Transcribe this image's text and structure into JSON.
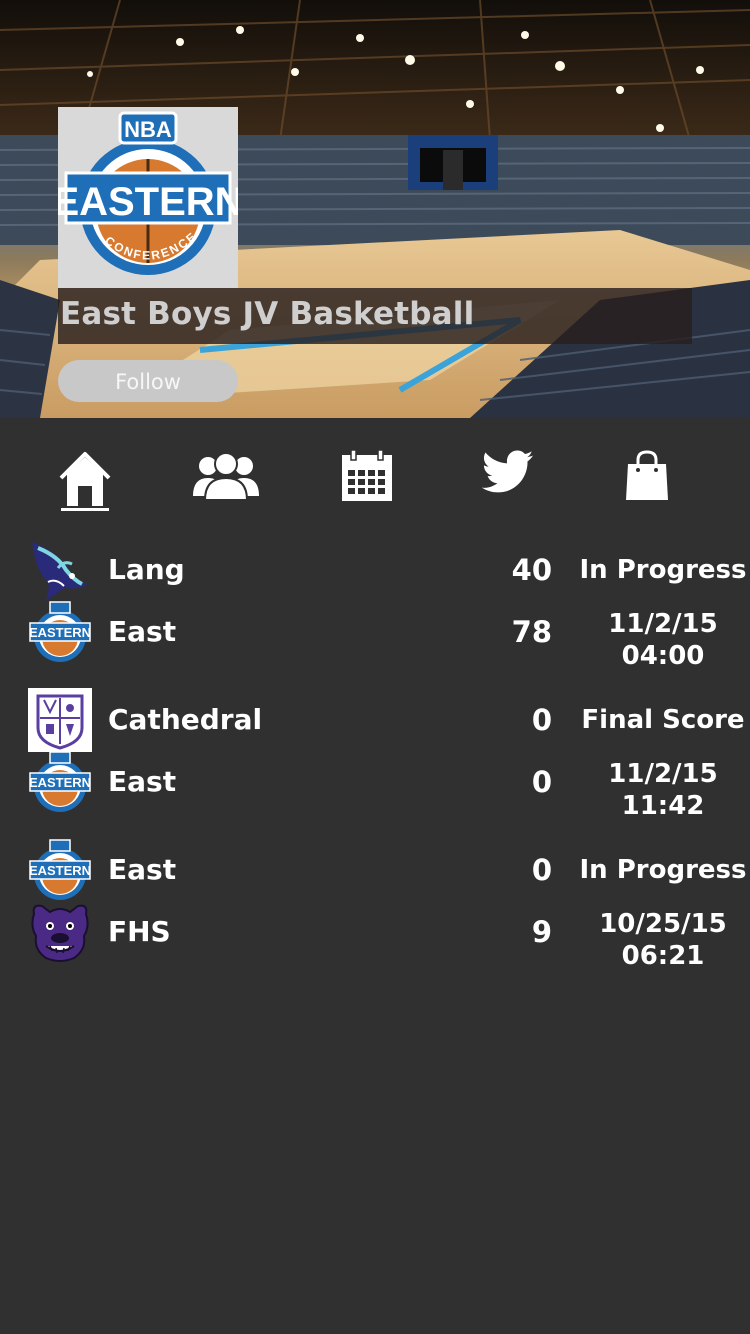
{
  "header": {
    "team_name": "East Boys JV Basketball",
    "follow_label": "Follow",
    "team_logo_text_top": "NBA",
    "team_logo_text_main": "EASTERN",
    "team_logo_text_bottom": "CONFERENCE"
  },
  "nav": [
    {
      "icon": "home-icon"
    },
    {
      "icon": "users-icon"
    },
    {
      "icon": "calendar-icon"
    },
    {
      "icon": "twitter-icon"
    },
    {
      "icon": "shopping-bag-icon"
    }
  ],
  "games": [
    {
      "team1": {
        "name": "Lang",
        "score": "40",
        "logo": "hornet-logo"
      },
      "team2": {
        "name": "East",
        "score": "78",
        "logo": "eastern-logo"
      },
      "status": "In Progress",
      "date": "11/2/15",
      "time": "04:00"
    },
    {
      "team1": {
        "name": "Cathedral",
        "score": "0",
        "logo": "cathedral-crest-logo"
      },
      "team2": {
        "name": "East",
        "score": "0",
        "logo": "eastern-logo"
      },
      "status": "Final Score",
      "date": "11/2/15",
      "time": "11:42"
    },
    {
      "team1": {
        "name": "East",
        "score": "0",
        "logo": "eastern-logo"
      },
      "team2": {
        "name": "FHS",
        "score": "9",
        "logo": "bulldog-logo"
      },
      "status": "In Progress",
      "date": "10/25/15",
      "time": "06:21"
    }
  ],
  "colors": {
    "background": "#303030",
    "eastern_blue": "#1e6fb8",
    "eastern_orange": "#d77a2f",
    "follow_button": "#c8c8c8",
    "bulldog_purple": "#4b2a86",
    "cathedral_purple": "#5a3ea0"
  }
}
